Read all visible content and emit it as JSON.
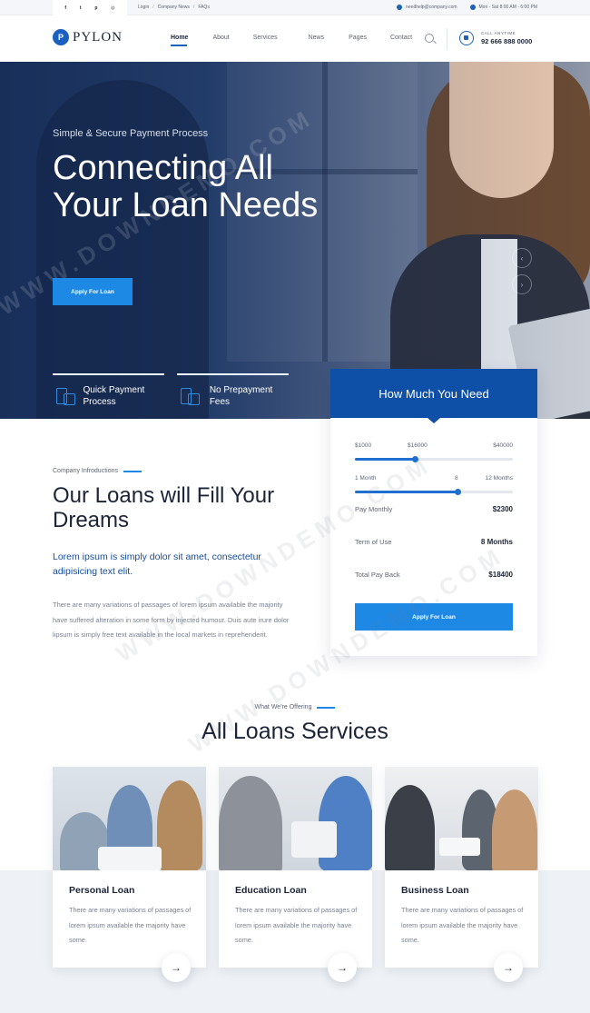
{
  "topbar": {
    "social_icons": [
      "facebook-icon",
      "twitter-icon",
      "pinterest-icon",
      "instagram-icon"
    ],
    "social_glyphs": [
      "f",
      "t",
      "p",
      "◎"
    ],
    "links": [
      "Login",
      "Company News",
      "FAQs"
    ],
    "separator": "/",
    "email": "needhelp@company.com",
    "hours": "Mon - Sat 8:00 AM - 6:00 PM"
  },
  "header": {
    "logo_mark": "P",
    "logo_text": "PYLON",
    "nav": [
      "Home",
      "About",
      "Services",
      "News",
      "Pages",
      "Contact"
    ],
    "active_nav": "Home",
    "call_label": "CALL ANYTIME",
    "call_number": "92 666 888 0000"
  },
  "hero": {
    "subtitle": "Simple & Secure Payment Process",
    "title": "Connecting All Your Loan Needs",
    "cta": "Apply For Loan",
    "arrows": [
      "‹",
      "›"
    ],
    "features": [
      {
        "label": "Quick Payment Process",
        "icon": "payment-icon"
      },
      {
        "label": "No Prepayment Fees",
        "icon": "fees-icon"
      }
    ]
  },
  "calculator": {
    "title": "How Much You Need",
    "amount": {
      "min": "$1000",
      "current": "$16000",
      "max": "$40000",
      "fraction": 0.38
    },
    "term": {
      "min": "1 Month",
      "current": "8",
      "max": "12 Months",
      "fraction": 0.65
    },
    "rows": [
      {
        "label": "Pay Monthly",
        "value": "$2300"
      },
      {
        "label": "Term of Use",
        "value": "8 Months"
      },
      {
        "label": "Total Pay Back",
        "value": "$18400"
      }
    ],
    "cta": "Apply For Loan"
  },
  "intro": {
    "kicker": "Company Infroductions",
    "title": "Our Loans will Fill Your Dreams",
    "lead": "Lorem ipsum is simply dolor sit amet, consectetur adipisicing text elit.",
    "body": "There are many variations of passages of lorem ipsum available the majority have suffered alteration in some form by injected humour. Duis aute irure dolor lipsum is simply free text available in the local markets in reprehenderit."
  },
  "services": {
    "kicker": "What We're Offering",
    "title": "All Loans Services",
    "cards": [
      {
        "title": "Personal Loan",
        "text": "There are many variations of passages of lorem ipsum available the majority have some."
      },
      {
        "title": "Education Loan",
        "text": "There are many variations of passages of lorem ipsum available the majority have some."
      },
      {
        "title": "Business Loan",
        "text": "There are many variations of passages of lorem ipsum available the majority have some."
      }
    ],
    "arrow_glyph": "→"
  },
  "watermark": "WWW.DOWNDEMO.COM",
  "colors": {
    "accent": "#1e88e5",
    "brand_dark": "#0e4fa7",
    "heading": "#1c2438",
    "lead_text": "#164c9c"
  }
}
